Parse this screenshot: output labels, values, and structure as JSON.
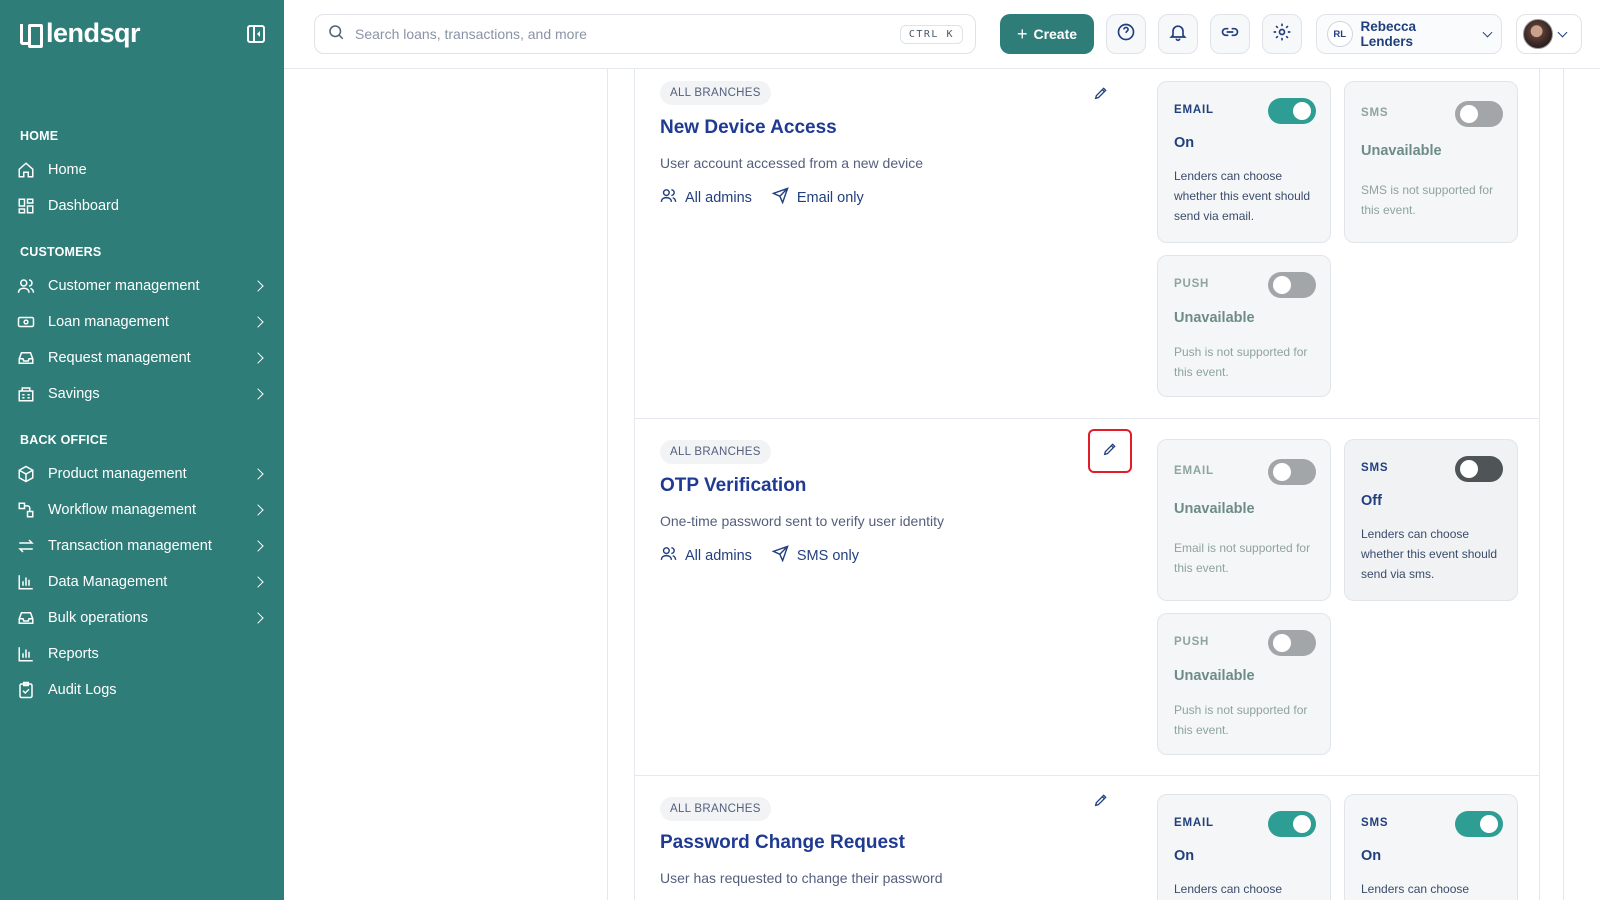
{
  "brand": {
    "name": "lendsqr"
  },
  "sidebar": {
    "sections": {
      "home": "HOME",
      "customers": "CUSTOMERS",
      "back_office": "BACK OFFICE"
    },
    "items": [
      {
        "label": "Home",
        "icon": "home-icon"
      },
      {
        "label": "Dashboard",
        "icon": "dashboard-icon"
      },
      {
        "label": "Customer management",
        "icon": "users-icon"
      },
      {
        "label": "Loan management",
        "icon": "money-icon"
      },
      {
        "label": "Request management",
        "icon": "inbox-icon"
      },
      {
        "label": "Savings",
        "icon": "savings-icon"
      },
      {
        "label": "Product management",
        "icon": "box-icon"
      },
      {
        "label": "Workflow management",
        "icon": "workflow-icon"
      },
      {
        "label": "Transaction management",
        "icon": "transfer-icon"
      },
      {
        "label": "Data Management",
        "icon": "bar-chart-icon"
      },
      {
        "label": "Bulk operations",
        "icon": "inbox-icon"
      },
      {
        "label": "Reports",
        "icon": "bar-chart-icon"
      },
      {
        "label": "Audit Logs",
        "icon": "clipboard-icon"
      }
    ]
  },
  "topbar": {
    "search_placeholder": "Search loans, transactions, and more",
    "shortcut": "CTRL K",
    "create_label": "Create",
    "user_initials": "RL",
    "user_name": "Rebecca Lenders"
  },
  "events": [
    {
      "badge": "ALL BRANCHES",
      "title": "New Device Access",
      "description": "User account accessed from a new device",
      "audience": "All admins",
      "delivery": "Email only",
      "channels": {
        "email": {
          "name": "EMAIL",
          "status": "On",
          "note": "Lenders can choose whether this event should send via email.",
          "state": "on"
        },
        "sms": {
          "name": "SMS",
          "status": "Unavailable",
          "note": "SMS is not supported for this event.",
          "state": "off"
        },
        "push": {
          "name": "PUSH",
          "status": "Unavailable",
          "note": "Push is not supported for this event.",
          "state": "off"
        }
      }
    },
    {
      "badge": "ALL BRANCHES",
      "title": "OTP Verification",
      "description": "One-time password sent to verify user identity",
      "audience": "All admins",
      "delivery": "SMS only",
      "channels": {
        "email": {
          "name": "EMAIL",
          "status": "Unavailable",
          "note": "Email is not supported for this event.",
          "state": "off"
        },
        "sms": {
          "name": "SMS",
          "status": "Off",
          "note": "Lenders can choose whether this event should send via sms.",
          "state": "off"
        },
        "push": {
          "name": "PUSH",
          "status": "Unavailable",
          "note": "Push is not supported for this event.",
          "state": "off"
        }
      }
    },
    {
      "badge": "ALL BRANCHES",
      "title": "Password Change Request",
      "description": "User has requested to change their password",
      "channels": {
        "email": {
          "name": "EMAIL",
          "status": "On",
          "note": "Lenders can choose",
          "state": "on"
        },
        "sms": {
          "name": "SMS",
          "status": "On",
          "note": "Lenders can choose",
          "state": "on"
        }
      }
    }
  ],
  "colors": {
    "brand": "#2e7d78",
    "toggle_on": "#2e9e94",
    "title": "#1f3a93",
    "highlight": "#e21d2a"
  }
}
